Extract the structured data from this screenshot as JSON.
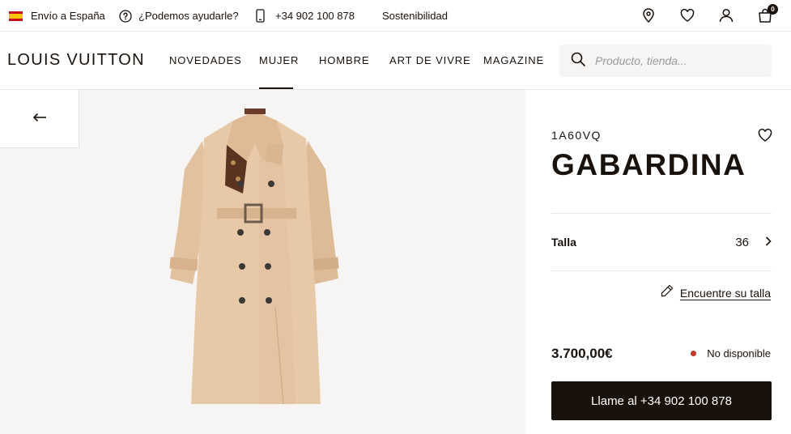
{
  "topbar": {
    "shipping": "Envío a España",
    "help": "¿Podemos ayudarle?",
    "phone": "+34 902 100 878",
    "sustainability": "Sostenibilidad",
    "icons": [
      "location-pin-icon",
      "heart-icon",
      "user-icon",
      "shopping-bag-icon"
    ],
    "cart_count": "0"
  },
  "header": {
    "logo": "LOUIS VUITTON",
    "nav": [
      "NOVEDADES",
      "MUJER",
      "HOMBRE",
      "ART DE VIVRE",
      "MAGAZINE"
    ],
    "active_nav": "MUJER",
    "search_placeholder": "Producto, tienda..."
  },
  "product": {
    "sku": "1A60VQ",
    "name": "GABARDINA",
    "size_label": "Talla",
    "size_value": "36",
    "find_size": "Encuentre su talla",
    "price": "3.700,00€",
    "availability": "No disponible",
    "call_button": "Llame al +34 902 100 878",
    "image": "beige-trench-coat"
  },
  "colors": {
    "ink": "#19110b",
    "gallery_bg": "#f6f5f3",
    "unavailable_dot": "#c0392b",
    "coat": "#e8c9a7"
  }
}
